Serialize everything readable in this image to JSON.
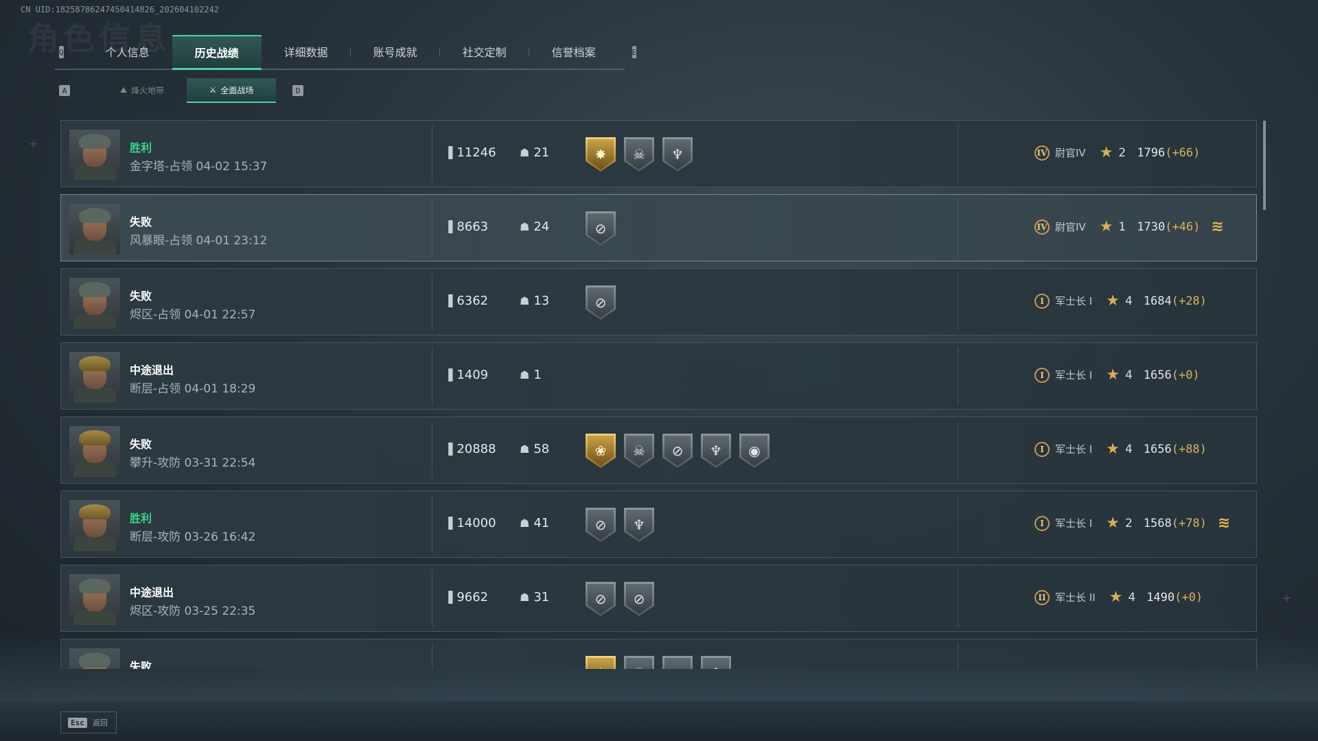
{
  "uid_text": "CN UID:182587862474504148​26_202604102242",
  "page_title_ghost": "角色信息",
  "tabs": {
    "prev_key": "Q",
    "next_key": "E",
    "items": [
      {
        "label": "个人信息"
      },
      {
        "label": "历史战绩",
        "active": true
      },
      {
        "label": "详细数据"
      },
      {
        "label": "账号成就"
      },
      {
        "label": "社交定制"
      },
      {
        "label": "信誉档案"
      }
    ]
  },
  "subtabs": {
    "prev_key": "A",
    "next_key": "D",
    "items": [
      {
        "label": "烽火地带"
      },
      {
        "label": "全面战场",
        "active": true
      }
    ]
  },
  "matches": [
    {
      "result": "胜利",
      "win": true,
      "map": "金字塔-占领 04-02 15:37",
      "score": "11246",
      "kills": "21",
      "medals": [
        {
          "icon": "burst",
          "gold": true
        },
        {
          "icon": "skull-target",
          "gold": false
        },
        {
          "icon": "eagle-skull",
          "gold": false
        }
      ],
      "rank_numeral": "IV",
      "rank_name": "尉官IV",
      "stars": "2",
      "rating": "1796",
      "delta": "(+66)",
      "promo": false,
      "avatar": "cap"
    },
    {
      "result": "失败",
      "win": false,
      "map": "风暴眼-占领 04-01 23:12",
      "score": "8663",
      "kills": "24",
      "medals": [
        {
          "icon": "crosshair",
          "gold": false
        }
      ],
      "rank_numeral": "IV",
      "rank_name": "尉官IV",
      "stars": "1",
      "rating": "1730",
      "delta": "(+46)",
      "promo": true,
      "avatar": "cap",
      "highlight": true
    },
    {
      "result": "失败",
      "win": false,
      "map": "烬区-占领 04-01 22:57",
      "score": "6362",
      "kills": "13",
      "medals": [
        {
          "icon": "crosshair",
          "gold": false
        }
      ],
      "rank_numeral": "I",
      "rank_name": "军士长 I",
      "stars": "4",
      "rating": "1684",
      "delta": "(+28)",
      "promo": false,
      "avatar": "cap"
    },
    {
      "result": "中途退出",
      "win": false,
      "map": "断层-占领 04-01 18:29",
      "score": "1409",
      "kills": "1",
      "medals": [],
      "rank_numeral": "I",
      "rank_name": "军士长 I",
      "stars": "4",
      "rating": "1656",
      "delta": "(+0)",
      "promo": false,
      "avatar": "gold"
    },
    {
      "result": "失败",
      "win": false,
      "map": "攀升-攻防 03-31 22:54",
      "score": "20888",
      "kills": "58",
      "medals": [
        {
          "icon": "flower-star",
          "gold": true
        },
        {
          "icon": "skull-target",
          "gold": false
        },
        {
          "icon": "crosshair",
          "gold": false
        },
        {
          "icon": "eagle-skull",
          "gold": false
        },
        {
          "icon": "eye-scope",
          "gold": false
        }
      ],
      "rank_numeral": "I",
      "rank_name": "军士长 I",
      "stars": "4",
      "rating": "1656",
      "delta": "(+88)",
      "promo": false,
      "avatar": "gold"
    },
    {
      "result": "胜利",
      "win": true,
      "map": "断层-攻防 03-26 16:42",
      "score": "14000",
      "kills": "41",
      "medals": [
        {
          "icon": "crosshair",
          "gold": false
        },
        {
          "icon": "eagle-skull",
          "gold": false
        }
      ],
      "rank_numeral": "I",
      "rank_name": "军士长 I",
      "stars": "2",
      "rating": "1568",
      "delta": "(+78)",
      "promo": true,
      "avatar": "gold"
    },
    {
      "result": "中途退出",
      "win": false,
      "map": "烬区-攻防 03-25 22:35",
      "score": "9662",
      "kills": "31",
      "medals": [
        {
          "icon": "crosshair",
          "gold": false
        },
        {
          "icon": "crosshair",
          "gold": false
        }
      ],
      "rank_numeral": "II",
      "rank_name": "军士长 II",
      "stars": "4",
      "rating": "1490",
      "delta": "(+0)",
      "promo": false,
      "avatar": "cap"
    },
    {
      "result": "失败",
      "win": false,
      "map": "",
      "score": "",
      "kills": "",
      "medals": [
        {
          "icon": "burst",
          "gold": true
        },
        {
          "icon": "skull-target",
          "gold": false
        },
        {
          "icon": "crosshair",
          "gold": false
        },
        {
          "icon": "eagle-skull",
          "gold": false
        }
      ],
      "rank_numeral": "",
      "rank_name": "",
      "stars": "",
      "rating": "",
      "delta": "",
      "promo": false,
      "avatar": "cap"
    }
  ],
  "footer": {
    "esc_key": "Esc",
    "back_label": "返回"
  },
  "colors": {
    "accent": "#4fd1a2",
    "win": "#37d58c",
    "gold": "#d9b35d"
  }
}
